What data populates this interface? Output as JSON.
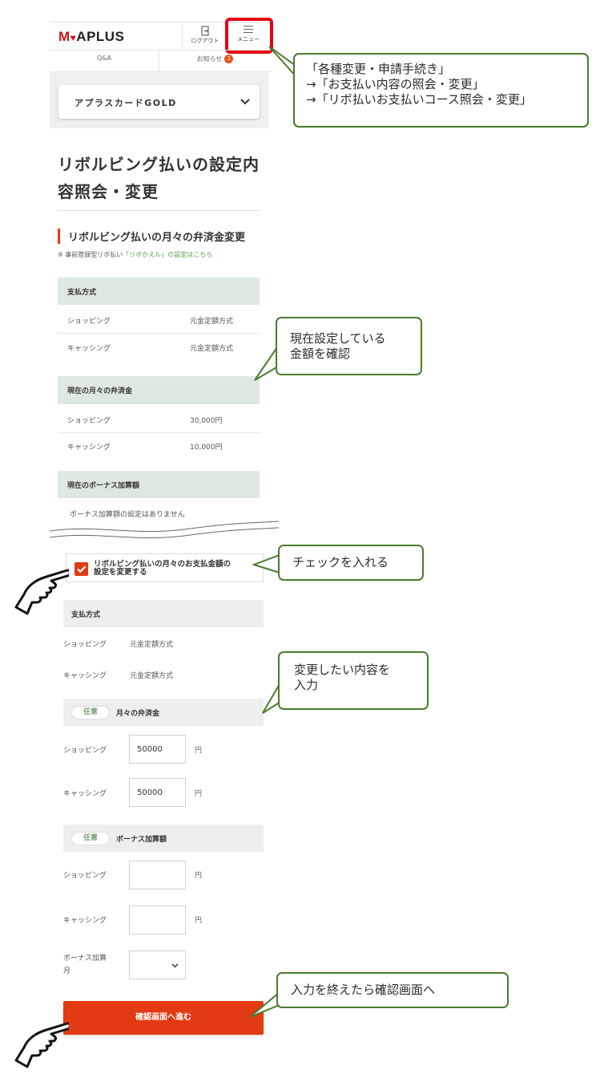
{
  "header": {
    "logo": {
      "my": "M",
      "heart": "♥",
      "text": "APLUS"
    },
    "logout_label": "ログアウト",
    "menu_label": "メニュー",
    "nav": {
      "qa": "Q&A",
      "notice": "お知らせ",
      "notice_count": "1"
    }
  },
  "card_select": {
    "value": "アプラスカードGOLD"
  },
  "page_title_line1": "リボルビング払いの設定内",
  "page_title_line2": "容照会・変更",
  "section_title": "リボルビング払いの月々の弁済金変更",
  "note": {
    "prefix": "※ 事前登録型リボ払い",
    "link": "「リボかえル」の設定はこちら"
  },
  "current": {
    "payment_method": {
      "header": "支払方式",
      "rows": [
        {
          "label": "ショッピング",
          "value": "元金定額方式"
        },
        {
          "label": "キャッシング",
          "value": "元金定額方式"
        }
      ]
    },
    "monthly": {
      "header": "現在の月々の弁済金",
      "rows": [
        {
          "label": "ショッピング",
          "value": "30,000円"
        },
        {
          "label": "キャッシング",
          "value": "10,000円"
        }
      ]
    },
    "bonus": {
      "header": "現在のボーナス加算額",
      "text": "ボーナス加算額の設定はありません"
    }
  },
  "change_checkbox": {
    "label_line1": "リボルビング払いの月々のお支払金額の",
    "label_line2": "設定を変更する",
    "checked": true
  },
  "form": {
    "method": {
      "header": "支払方式",
      "rows": [
        {
          "label": "ショッピング",
          "value": "元金定額方式"
        },
        {
          "label": "キャッシング",
          "value": "元金定額方式"
        }
      ]
    },
    "monthly": {
      "badge": "任意",
      "header": "月々の弁済金",
      "shopping_label": "ショッピング",
      "shopping_value": "50000",
      "cashing_label": "キャッシング",
      "cashing_value": "50000",
      "unit": "円"
    },
    "bonus": {
      "badge": "任意",
      "header": "ボーナス加算額",
      "shopping_label": "ショッピング",
      "shopping_value": "",
      "cashing_label": "キャッシング",
      "cashing_value": "",
      "unit": "円",
      "month_label_line1": "ボーナス加算",
      "month_label_line2": "月"
    },
    "submit_label": "確認画面へ進む"
  },
  "callouts": {
    "menu": [
      "「各種変更・申請手続き」",
      "→「お支払い内容の照会・変更」",
      "→「リボ払いお支払いコース照会・変更」"
    ],
    "current": [
      "現在設定している",
      "金額を確認"
    ],
    "check": "チェックを入れる",
    "change": [
      "変更したい内容を",
      "入力"
    ],
    "submit": "入力を終えたら確認画面へ"
  },
  "colors": {
    "accent_red": "#e23a12",
    "highlight_red": "#e60012",
    "callout_green": "#4a7b2e",
    "band_green": "#dde9df",
    "link_green": "#5b9a47"
  }
}
